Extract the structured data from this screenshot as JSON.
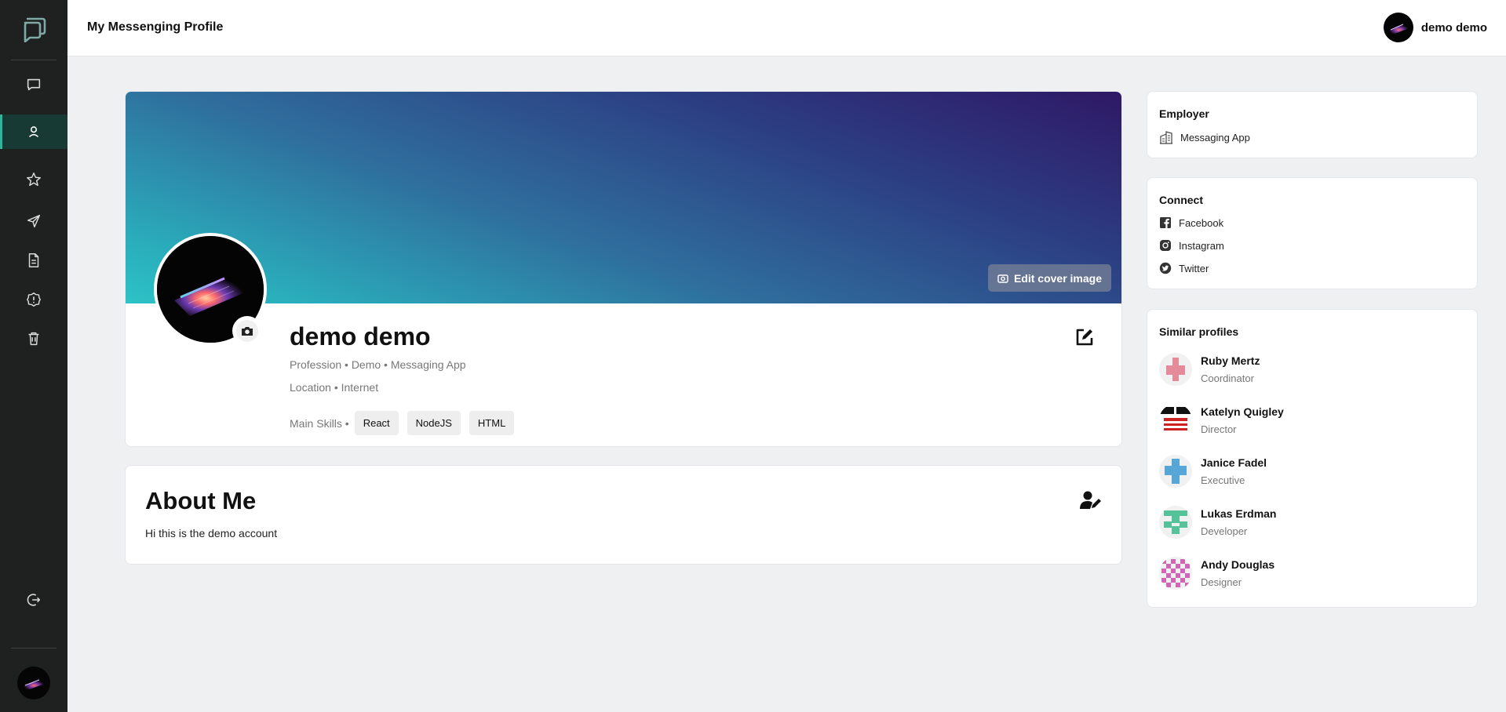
{
  "header": {
    "title": "My Messenging Profile",
    "username": "demo demo"
  },
  "sidebar": {
    "items": [
      {
        "icon": "chat-icon",
        "active": false
      },
      {
        "icon": "user-icon",
        "active": true
      },
      {
        "icon": "star-icon",
        "active": false
      },
      {
        "icon": "send-icon",
        "active": false
      },
      {
        "icon": "file-icon",
        "active": false
      },
      {
        "icon": "alert-icon",
        "active": false
      },
      {
        "icon": "trash-icon",
        "active": false
      }
    ],
    "logout_icon": "logout-icon"
  },
  "profile": {
    "name": "demo demo",
    "edit_cover_label": "Edit cover image",
    "profession_line": "Profession • Demo • Messaging App",
    "location_line": "Location • Internet",
    "skills_label": "Main Skills •",
    "skills": [
      "React",
      "NodeJS",
      "HTML"
    ]
  },
  "about": {
    "title": "About Me",
    "text": "Hi this is the demo account"
  },
  "employer": {
    "title": "Employer",
    "name": "Messaging App"
  },
  "connect": {
    "title": "Connect",
    "links": [
      "Facebook",
      "Instagram",
      "Twitter"
    ]
  },
  "similar": {
    "title": "Similar profiles",
    "profiles": [
      {
        "name": "Ruby Mertz",
        "role": "Coordinator"
      },
      {
        "name": "Katelyn Quigley",
        "role": "Director"
      },
      {
        "name": "Janice Fadel",
        "role": "Executive"
      },
      {
        "name": "Lukas Erdman",
        "role": "Developer"
      },
      {
        "name": "Andy Douglas",
        "role": "Designer"
      }
    ]
  },
  "colors": {
    "sidebar_bg": "#1f2020",
    "accent": "#2fb69a",
    "cover_start": "#2cc3c6",
    "cover_end": "#2f1866"
  }
}
